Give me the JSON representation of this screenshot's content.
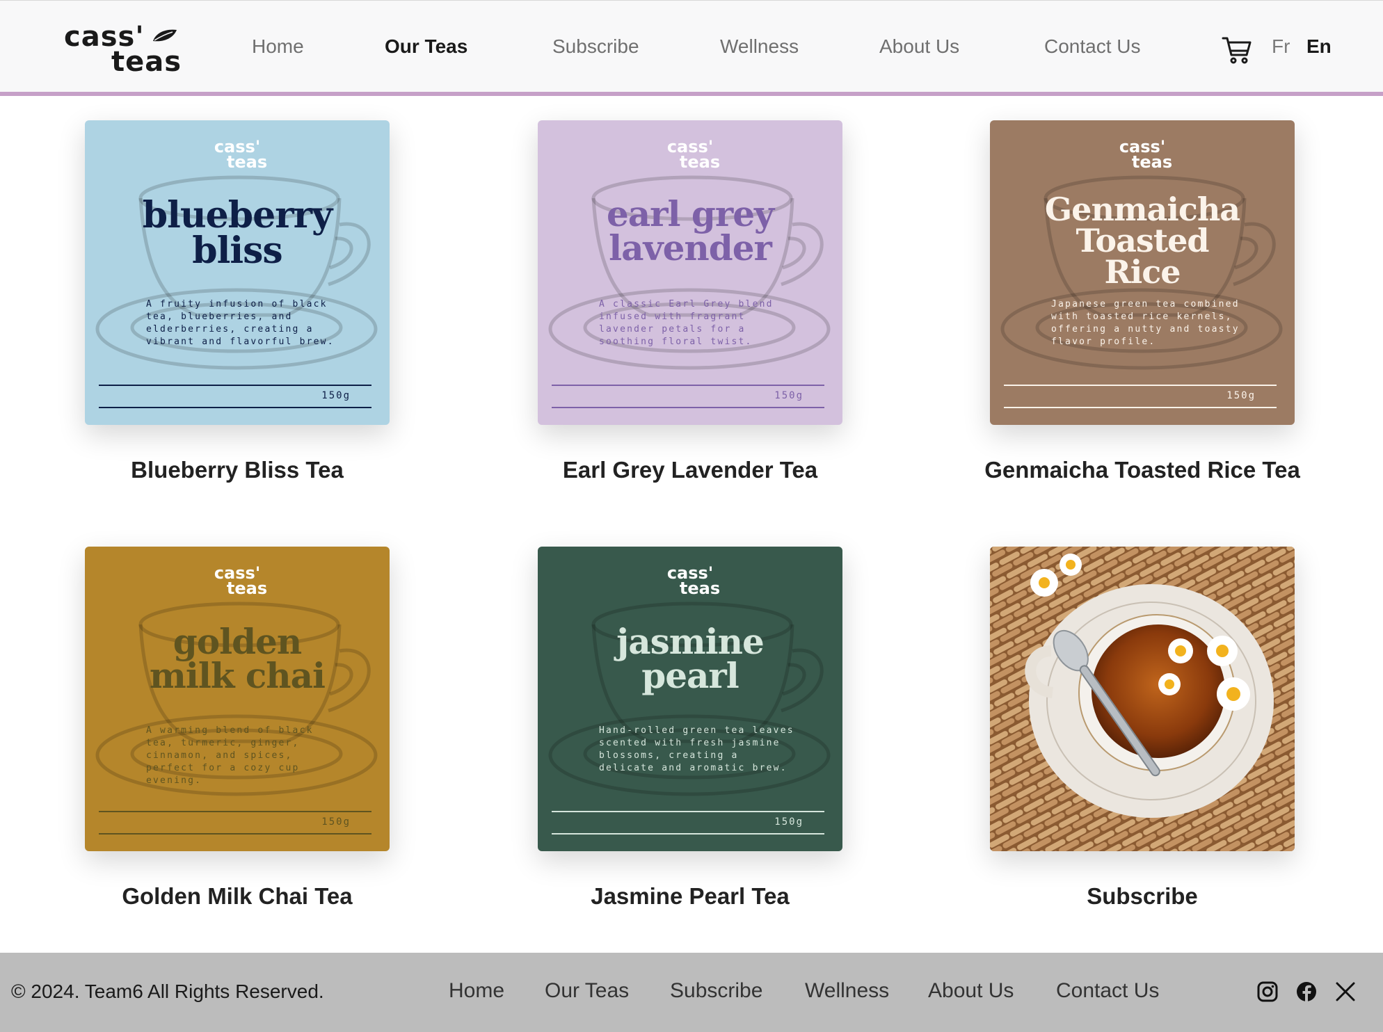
{
  "brand": {
    "line1": "cass'",
    "line2": "teas"
  },
  "nav": {
    "items": [
      "Home",
      "Our Teas",
      "Subscribe",
      "Wellness",
      "About Us",
      "Contact Us"
    ],
    "active": "Our Teas",
    "icons": {
      "cart": "cart-icon"
    },
    "lang_fr": "Fr",
    "lang_en": "En"
  },
  "products": [
    {
      "title": "Blueberry Bliss Tea",
      "package": {
        "name_line1": "blueberry",
        "name_line2": "bliss",
        "name_line3": "",
        "description": "A fruity infusion of black tea, blueberries, and elderberries, creating a vibrant and flavorful brew.",
        "weight": "150g",
        "colors": {
          "bg": "#aed3e3",
          "text": "#0e1f47",
          "brand": "#ffffff"
        }
      }
    },
    {
      "title": "Earl Grey Lavender Tea",
      "package": {
        "name_line1": "earl grey",
        "name_line2": "lavender",
        "name_line3": "",
        "description": "A classic Earl Grey blend infused with fragrant lavender petals for a soothing floral twist.",
        "weight": "150g",
        "colors": {
          "bg": "#d3c1dd",
          "text": "#7d61a8",
          "brand": "#ffffff"
        }
      }
    },
    {
      "title": "Genmaicha Toasted Rice Tea",
      "package": {
        "name_line1": "Genmaicha",
        "name_line2": "Toasted",
        "name_line3": "Rice",
        "description": "Japanese green tea combined with toasted rice kernels, offering a nutty and toasty flavor profile.",
        "weight": "150g",
        "colors": {
          "bg": "#9c7b63",
          "text": "#fbf3ea",
          "brand": "#ffffff"
        }
      }
    },
    {
      "title": "Golden Milk Chai Tea",
      "package": {
        "name_line1": "golden",
        "name_line2": "milk chai",
        "name_line3": "",
        "description": "A warming blend of black tea, turmeric, ginger, cinnamon, and spices, perfect for a cozy cup evening.",
        "weight": "150g",
        "colors": {
          "bg": "#b5862b",
          "text": "#5f5420",
          "brand": "#ffffff"
        }
      }
    },
    {
      "title": "Jasmine Pearl Tea",
      "package": {
        "name_line1": "jasmine",
        "name_line2": "pearl",
        "name_line3": "",
        "description": "Hand-rolled green tea leaves scented with fresh jasmine blossoms, creating a delicate and aromatic brew.",
        "weight": "150g",
        "colors": {
          "bg": "#38594c",
          "text": "#d6e6dc",
          "brand": "#ffffff"
        }
      }
    }
  ],
  "subscribe_card": {
    "title": "Subscribe",
    "image": "tea-cup-with-chamomile-photo"
  },
  "footer": {
    "copyright": "© 2024. Team6 All Rights Reserved.",
    "links": [
      "Home",
      "Our Teas",
      "Subscribe",
      "Wellness",
      "About Us",
      "Contact Us"
    ],
    "social_icons": [
      "instagram-icon",
      "facebook-icon",
      "x-icon"
    ]
  },
  "colors": {
    "accent": "#c6a0c8",
    "footer_bg": "#bcbcbc",
    "header_bg": "#f8f8f9"
  }
}
